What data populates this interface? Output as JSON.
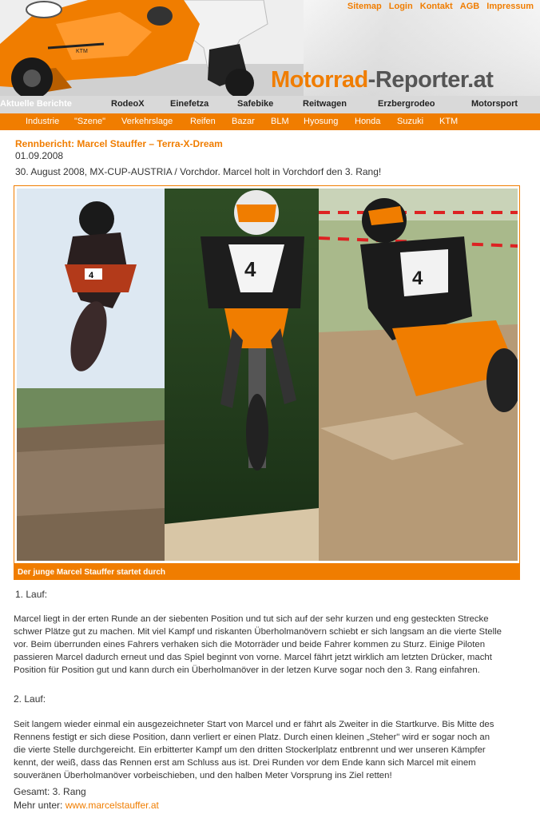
{
  "header": {
    "top_links": [
      "Sitemap",
      "Login",
      "Kontakt",
      "AGB",
      "Impressum"
    ],
    "logo_part1": "Motorrad",
    "logo_part2": "-Reporter.at",
    "accent_color": "#f07d00"
  },
  "nav_primary": [
    "Aktuelle Berichte",
    "RodeoX",
    "Einefetza",
    "Safebike",
    "Reitwagen",
    "Erzbergrodeo",
    "Motorsport"
  ],
  "nav_secondary": [
    "Industrie",
    "\"Szene\"",
    "Verkehrslage",
    "Reifen",
    "Bazar",
    "BLM",
    "Hyosung",
    "Honda",
    "Suzuki",
    "KTM"
  ],
  "article": {
    "title": "Rennbericht: Marcel Stauffer – Terra-X-Dream",
    "date": "01.09.2008",
    "lead": "30. August 2008, MX-CUP-AUSTRIA / Vorchdor. Marcel holt in Vorchdorf den 3. Rang!",
    "photo_caption": "Der junge Marcel Stauffer startet durch",
    "lauf1_heading": "1. Lauf:",
    "lauf1_lines": [
      "Marcel liegt in der erten Runde an der siebenten Position und tut sich auf der sehr kurzen und eng gesteckten Strecke",
      "schwer Plätze gut zu machen. Mit viel Kampf und riskanten Überholmanövern schiebt er sich langsam an die vierte Stelle",
      "vor. Beim überrunden eines Fahrers verhaken sich die Motorräder und beide Fahrer kommen zu Sturz. Einige Piloten",
      "passieren Marcel dadurch erneut und das Spiel beginnt von vorne. Marcel fährt jetzt wirklich am letzten Drücker, macht",
      "Position für Position gut und kann durch ein Überholmanöver in der letzen Kurve sogar noch den 3. Rang einfahren."
    ],
    "lauf2_heading": "2. Lauf:",
    "lauf2_lines": [
      "Seit langem wieder einmal ein ausgezeichneter Start von Marcel und er fährt als Zweiter in die Startkurve. Bis Mitte des",
      "Rennens festigt er sich diese Position, dann verliert er einen Platz. Durch einen kleinen „Steher\" wird er sogar noch an",
      "die vierte Stelle durchgereicht. Ein erbitterter Kampf um den dritten Stockerlplatz entbrennt und wer unseren Kämpfer",
      "kennt, der weiß, dass das Rennen erst am Schluss aus ist. Drei Runden vor dem Ende kann sich Marcel mit einem",
      "souveränen Überholmanöver vorbeischieben, und den halben Meter Vorsprung ins Ziel retten!"
    ],
    "gesamt": "Gesamt: 3. Rang",
    "mehr_label": "Mehr unter: ",
    "mehr_link": "www.marcelstauffer.at"
  }
}
